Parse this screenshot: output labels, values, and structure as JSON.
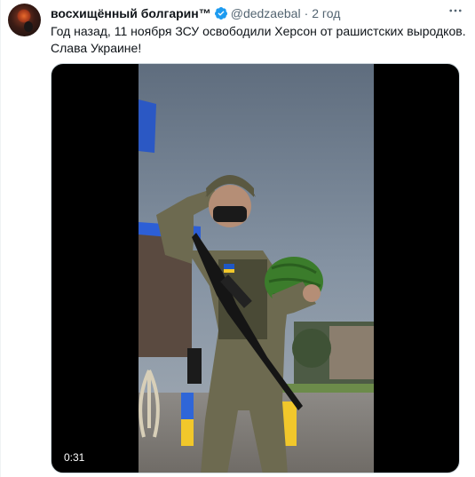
{
  "tweet": {
    "author_name": "восхищённый болгарин™",
    "handle": "@dedzaebal",
    "separator": "·",
    "time": "2 год",
    "text": "Год назад, 11 ноября ЗСУ освободили Херсон от рашистских выродков. Слава Украине!",
    "verified_icon": "verified-badge-icon",
    "more_icon": "more-options-icon"
  },
  "video": {
    "duration": "0:31",
    "description_icons": [
      "soldier-saluting",
      "watermelon",
      "rifle",
      "trident-monument",
      "ukrainian-flag"
    ]
  },
  "colors": {
    "verified": "#1d9bf0",
    "secondary_text": "#536471",
    "primary_text": "#0f1419"
  }
}
